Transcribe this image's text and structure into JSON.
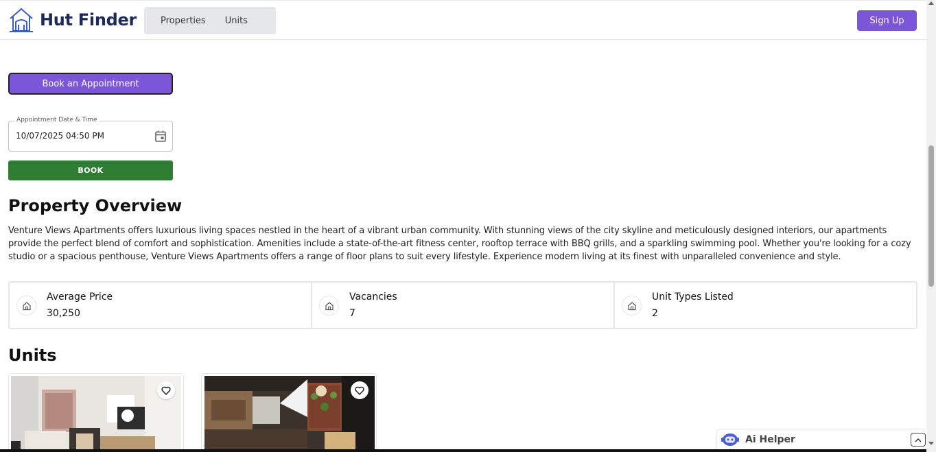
{
  "header": {
    "brand": "Hut Finder",
    "nav": [
      "Properties",
      "Units"
    ],
    "signup_label": "Sign Up"
  },
  "appointment": {
    "toggle_label": "Book an Appointment",
    "date_label": "Appointment Date & Time",
    "date_value": "10/07/2025 04:50 PM",
    "book_label": "BOOK"
  },
  "overview": {
    "title": "Property Overview",
    "description": "Venture Views Apartments offers luxurious living spaces nestled in the heart of a vibrant urban community. With stunning views of the city skyline and meticulously designed interiors, our apartments provide the perfect blend of comfort and sophistication. Amenities include a state-of-the-art fitness center, rooftop terrace with BBQ grills, and a sparkling swimming pool. Whether you're looking for a cozy studio or a spacious penthouse, Venture Views Apartments offers a range of floor plans to suit every lifestyle. Experience modern living at its finest with unparalleled convenience and style."
  },
  "stats": [
    {
      "label": "Average Price",
      "value": "30,250",
      "icon": "home-icon"
    },
    {
      "label": "Vacancies",
      "value": "7",
      "icon": "home-icon"
    },
    {
      "label": "Unit Types Listed",
      "value": "2",
      "icon": "home-icon"
    }
  ],
  "units": {
    "title": "Units",
    "cards": [
      {
        "image": "living-room-photo",
        "icon": "heart-icon"
      },
      {
        "image": "kitchen-photo",
        "icon": "heart-icon"
      }
    ]
  },
  "ai_helper": {
    "label": "Ai Helper",
    "icon": "robot-icon"
  },
  "colors": {
    "brand": "#1e2a5a",
    "accent": "#7c56d8",
    "book": "#2e7d32"
  }
}
